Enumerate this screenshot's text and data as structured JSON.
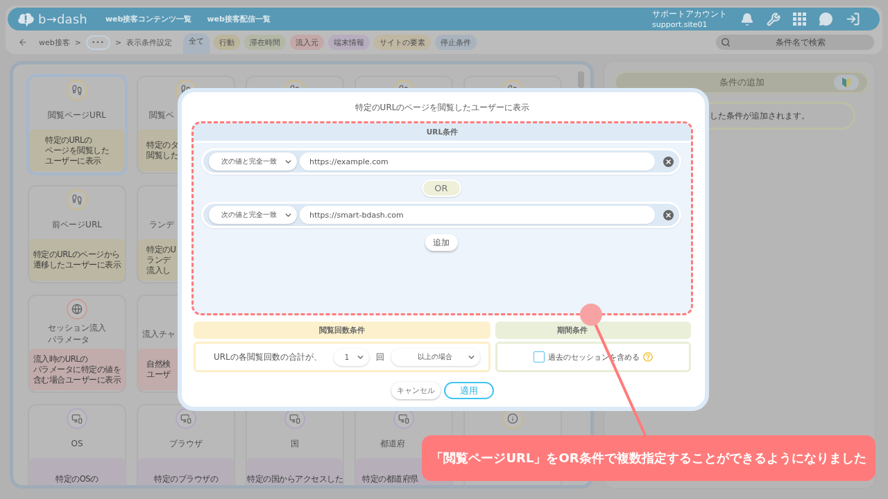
{
  "header": {
    "logo": "b→dash",
    "nav": [
      {
        "label": "web接客コンテンツ一覧"
      },
      {
        "label": "web接客配信一覧"
      }
    ],
    "account": {
      "name": "サポートアカウント",
      "id": "support.site01"
    }
  },
  "breadcrumb": [
    {
      "kind": "link",
      "label": "web接客"
    },
    {
      "kind": "separator",
      "label": ">"
    },
    {
      "kind": "more",
      "label": "•••"
    },
    {
      "kind": "separator",
      "label": ">"
    },
    {
      "kind": "current",
      "label": "表示条件設定"
    }
  ],
  "filter_tabs": [
    {
      "label": "全て",
      "selected": true,
      "color": "#a9b5c0"
    },
    {
      "label": "行動",
      "selected": false,
      "color": "#bab59b"
    },
    {
      "label": "滞在時間",
      "selected": false,
      "color": "#b2b8a5"
    },
    {
      "label": "流入元",
      "selected": false,
      "color": "#c4a7a7"
    },
    {
      "label": "端末情報",
      "selected": false,
      "color": "#b7adbf"
    },
    {
      "label": "サイトの要素",
      "selected": false,
      "color": "#c0b7a3"
    },
    {
      "label": "停止条件",
      "selected": false,
      "color": "#a9b3bd"
    }
  ],
  "search": {
    "placeholder": "条件名で検索"
  },
  "card_grid": [
    [
      {
        "kind": "behavior",
        "title": [
          "閲覧ページURL"
        ],
        "description": [
          "特定のURLの",
          "ページを閲覧した",
          "ユーザーに表示"
        ],
        "selected": true
      },
      {
        "kind": "behavior",
        "title": [
          "閲覧ペ"
        ],
        "description": [
          "特定のタ",
          "閲覧した"
        ],
        "selected": false
      },
      {
        "kind": "behavior",
        "selected": false
      },
      {
        "kind": "behavior",
        "selected": false
      },
      {
        "kind": "behavior",
        "selected": false
      }
    ],
    [
      {
        "kind": "behavior",
        "title": [
          "前ページURL"
        ],
        "description": [
          "特定のURLのページから",
          "遷移したユーザーに表示"
        ],
        "selected": false
      },
      {
        "kind": "behavior",
        "title": [
          "ランデ"
        ],
        "description": [
          "特定のU",
          "ランデ",
          "流入し"
        ],
        "selected": false
      }
    ],
    [
      {
        "kind": "inflow",
        "title": [
          "セッション流入",
          "パラメータ"
        ],
        "description": [
          "流入時のURLの",
          "パラメータに特定の値を",
          "含む場合ユーザーに表示"
        ],
        "selected": false
      },
      {
        "kind": "inflow",
        "title": [
          "流入チャ"
        ],
        "description": [
          "自然検",
          "ユーザ"
        ],
        "selected": false
      }
    ],
    [
      {
        "kind": "device",
        "title": [
          "OS"
        ],
        "description": [
          "特定のOSの"
        ],
        "selected": false
      },
      {
        "kind": "device",
        "title": [
          "ブラウザ"
        ],
        "description": [
          "特定のブラウザの"
        ],
        "selected": false
      },
      {
        "kind": "device",
        "title": [
          "国"
        ],
        "description": [
          "特定の国からアクセスした"
        ],
        "selected": false
      },
      {
        "kind": "device",
        "title": [
          "都道府"
        ],
        "description": [
          "特定の都道府県"
        ],
        "selected": false
      },
      {
        "kind": "site_element",
        "selected": false
      }
    ]
  ],
  "right_panel": {
    "heading": "条件の追加",
    "hint": "した条件が追加されます。"
  },
  "modal": {
    "title": "特定のURLのページを閲覧したユーザーに表示",
    "url_section": {
      "heading": "URL条件",
      "conditions": [
        {
          "match": "次の値と完全一致",
          "value": "https://example.com"
        },
        {
          "match": "次の値と完全一致",
          "value": "https://smart-bdash.com"
        }
      ],
      "connector": "OR",
      "add_button": "追加"
    },
    "count_section": {
      "heading": "閲覧回数条件",
      "prefix": "URLの各閲覧回数の合計が、",
      "count": "1",
      "unit": "回",
      "comparison": "以上の場合"
    },
    "period_section": {
      "heading": "期間条件",
      "include_past": {
        "label": "過去のセッションを含める",
        "checked": false
      }
    },
    "buttons": [
      {
        "kind": "cancel",
        "label": "キャンセル"
      },
      {
        "kind": "apply",
        "label": "適用"
      }
    ]
  },
  "annotation": {
    "callout": "「閲覧ページURL」をOR条件で複数指定することができるようになりました"
  }
}
